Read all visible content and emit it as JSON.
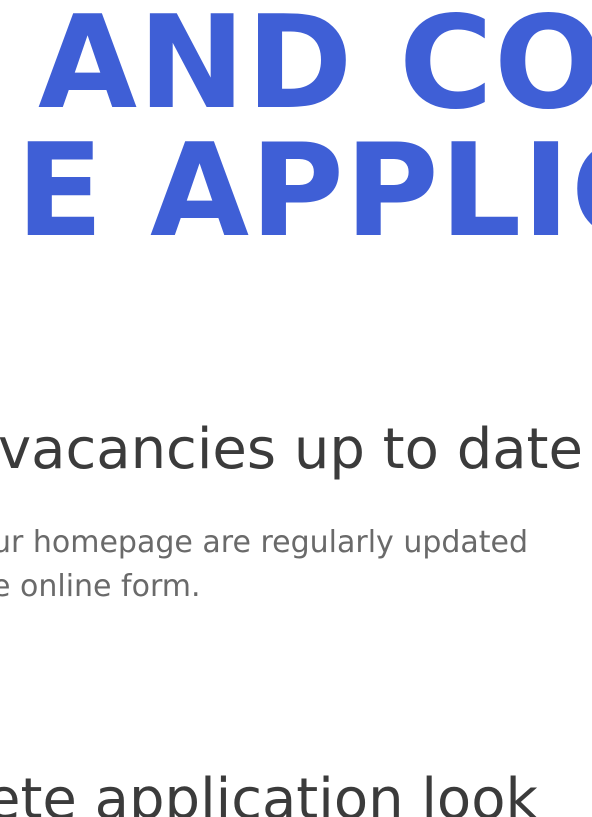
{
  "colors": {
    "hero": "#3f5fd6",
    "heading": "#3b3b3b",
    "body": "#6a6a6a",
    "background": "#ffffff"
  },
  "hero": {
    "line_1": "AND COM",
    "line_2": "E APPLIC"
  },
  "section_1": {
    "heading": "vacancies up to date",
    "body_line_1": "ur homepage are regularly updated",
    "body_line_2": "e online form."
  },
  "section_2": {
    "heading": "ete application look"
  }
}
